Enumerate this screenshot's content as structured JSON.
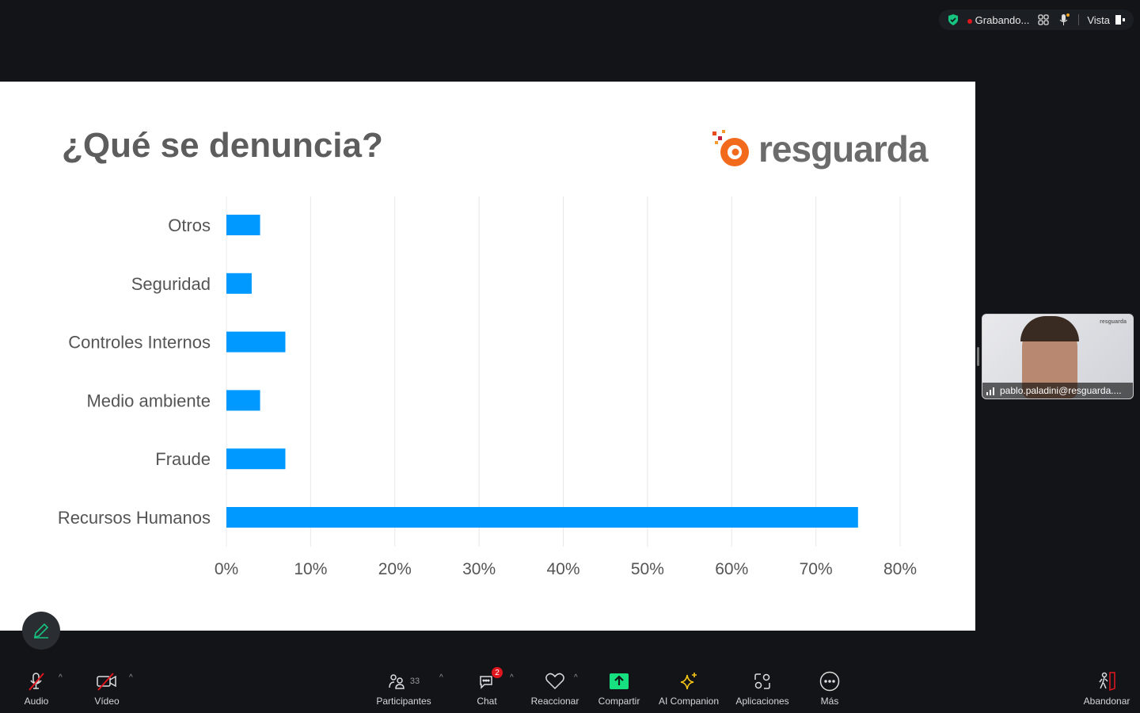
{
  "topbar": {
    "recording": "Grabando...",
    "view": "Vista",
    "colors": {
      "shield": "#16c47f",
      "rec": "#e0161e"
    }
  },
  "slide": {
    "title": "¿Qué se denuncia?",
    "logo": "resguarda"
  },
  "chart_data": {
    "type": "bar",
    "orientation": "horizontal",
    "categories": [
      "Otros",
      "Seguridad",
      "Controles Internos",
      "Medio ambiente",
      "Fraude",
      "Recursos Humanos"
    ],
    "values": [
      4,
      3,
      7,
      4,
      7,
      75
    ],
    "xlim": [
      0,
      80
    ],
    "xticks": [
      "0%",
      "10%",
      "20%",
      "30%",
      "40%",
      "50%",
      "60%",
      "70%",
      "80%"
    ],
    "grid": true,
    "bar_color": "#0099ff"
  },
  "video": {
    "name": "pablo.paladini@resguarda....",
    "logo": "resguarda"
  },
  "toolbar": {
    "audio": "Audio",
    "video": "Vídeo",
    "participants": "Participantes",
    "participants_count": "33",
    "chat": "Chat",
    "chat_badge": "2",
    "react": "Reaccionar",
    "share": "Compartir",
    "ai": "AI Companion",
    "apps": "Aplicaciones",
    "more": "Más",
    "leave": "Abandonar"
  }
}
